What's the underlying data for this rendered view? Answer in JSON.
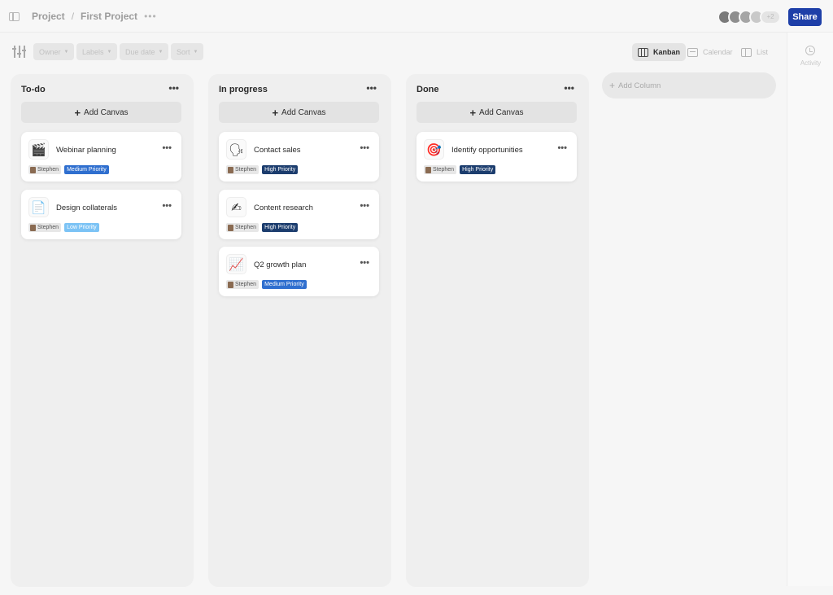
{
  "breadcrumb": {
    "project": "Project",
    "separator": "/",
    "current": "First Project",
    "more": "•••"
  },
  "header": {
    "share_label": "Share",
    "avatar_overflow": "+2"
  },
  "toolbar": {
    "filters": [
      {
        "label": "Owner"
      },
      {
        "label": "Labels"
      },
      {
        "label": "Due date"
      },
      {
        "label": "Sort"
      }
    ],
    "views": [
      {
        "label": "Kanban",
        "icon": "kanban-icon",
        "active": true
      },
      {
        "label": "Calendar",
        "icon": "calendar-icon",
        "active": false
      },
      {
        "label": "List",
        "icon": "list-icon",
        "active": false
      }
    ]
  },
  "activity": {
    "label": "Activity"
  },
  "colors": {
    "share": "#1e3fa8",
    "medium_priority": "#2f6fcf",
    "high_priority": "#1c3d6e",
    "low_priority": "#7cc3f5"
  },
  "columns": [
    {
      "title": "To-do",
      "more": "•••",
      "add_label": "Add Canvas",
      "cards": [
        {
          "icon": "🎬",
          "title": "Webinar planning",
          "owner": "Stephen",
          "priority": "Medium Priority",
          "priority_color": "#2f6fcf"
        },
        {
          "icon": "📄",
          "title": "Design collaterals",
          "owner": "Stephen",
          "priority": "Low Priority",
          "priority_color": "#7cc3f5"
        }
      ]
    },
    {
      "title": "In progress",
      "more": "•••",
      "add_label": "Add Canvas",
      "cards": [
        {
          "icon": "🗣",
          "title": "Contact sales",
          "owner": "Stephen",
          "priority": "High Priority",
          "priority_color": "#1c3d6e"
        },
        {
          "icon": "✍",
          "title": "Content research",
          "owner": "Stephen",
          "priority": "High Priority",
          "priority_color": "#1c3d6e"
        },
        {
          "icon": "📈",
          "title": "Q2 growth plan",
          "owner": "Stephen",
          "priority": "Medium Priority",
          "priority_color": "#2f6fcf"
        }
      ]
    },
    {
      "title": "Done",
      "more": "•••",
      "add_label": "Add Canvas",
      "cards": [
        {
          "icon": "🎯",
          "title": "Identify opportunities",
          "owner": "Stephen",
          "priority": "High Priority",
          "priority_color": "#1c3d6e"
        }
      ]
    }
  ],
  "add_column_label": "Add Column",
  "card_more": "•••"
}
